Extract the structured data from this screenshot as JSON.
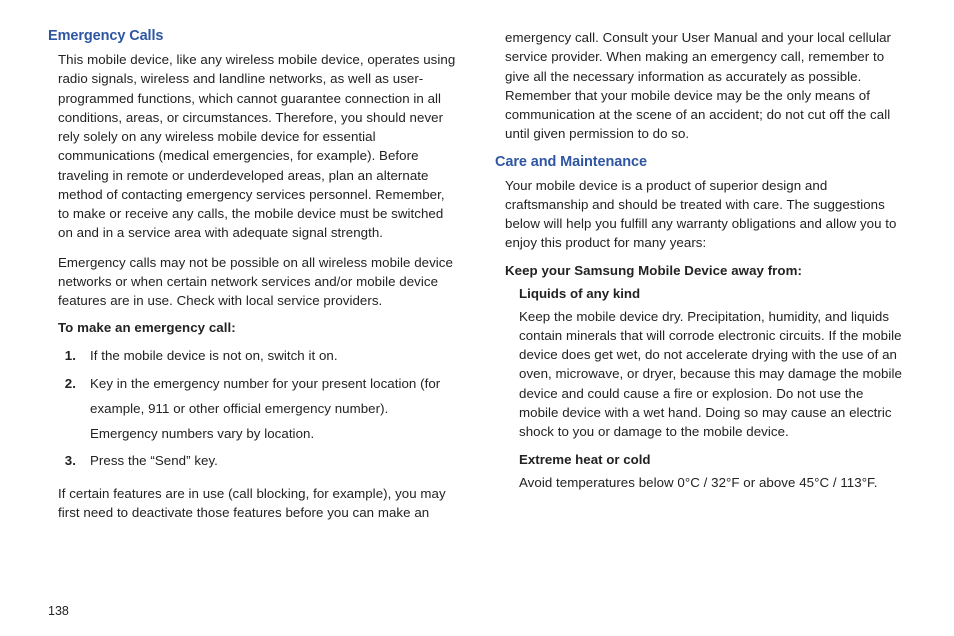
{
  "left": {
    "heading1": "Emergency Calls",
    "para1": "This mobile device, like any wireless mobile device, operates using radio signals, wireless and landline networks, as well as user-programmed functions, which cannot guarantee connection in all conditions, areas, or circumstances. Therefore, you should never rely solely on any wireless mobile device for essential communications (medical emergencies, for example). Before traveling in remote or underdeveloped areas, plan an alternate method of contacting emergency services personnel. Remember, to make or receive any calls, the mobile device must be switched on and in a service area with adequate signal strength.",
    "para2": "Emergency calls may not be possible on all wireless mobile device networks or when certain network services and/or mobile device features are in use. Check with local service providers.",
    "listHeading": "To make an emergency call:",
    "steps": [
      {
        "num": "1.",
        "text": "If the mobile device is not on, switch it on."
      },
      {
        "num": "2.",
        "text": "Key in the emergency number for your present location (for example, 911 or other official emergency number). Emergency numbers vary by location."
      },
      {
        "num": "3.",
        "text": "Press the “Send” key."
      }
    ],
    "para3": "If certain features are in use (call blocking, for example), you may first need to deactivate those features before you can make an"
  },
  "right": {
    "paraCont": "emergency call. Consult your User Manual and your local cellular service provider. When making an emergency call, remember to give all the necessary information as accurately as possible. Remember that your mobile device may be the only means of communication at the scene of an accident; do not cut off the call until given permission to do so.",
    "heading2": "Care and Maintenance",
    "para4": "Your mobile device is a product of superior design and craftsmanship and should be treated with care. The suggestions below will help you fulfill any warranty obligations and allow you to enjoy this product for many years:",
    "sub1": "Keep your Samsung Mobile Device away from:",
    "sub1a": "Liquids of any kind",
    "sub1aText": "Keep the mobile device dry. Precipitation, humidity, and liquids contain minerals that will corrode electronic circuits. If the mobile device does get wet, do not accelerate drying with the use of an oven, microwave, or dryer, because this may damage the mobile device and could cause a fire or explosion. Do not use the mobile device with a wet hand. Doing so may cause an electric shock to you or damage to the mobile device.",
    "sub1b": "Extreme heat or cold",
    "sub1bText": "Avoid temperatures below 0°C / 32°F or above 45°C / 113°F."
  },
  "pageNumber": "138"
}
